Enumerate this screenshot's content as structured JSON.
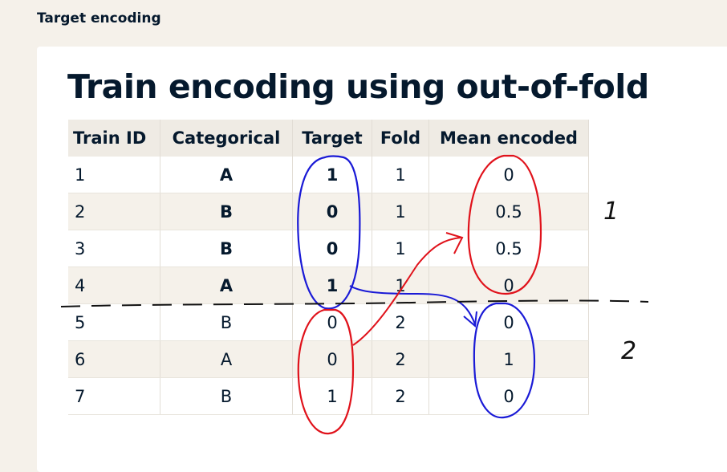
{
  "section_label": "Target encoding",
  "title": "Train encoding using out-of-fold",
  "table": {
    "headers": [
      "Train ID",
      "Categorical",
      "Target",
      "Fold",
      "Mean encoded"
    ],
    "rows": [
      {
        "id": "1",
        "categorical": "A",
        "target": "1",
        "fold": "1",
        "mean": "0"
      },
      {
        "id": "2",
        "categorical": "B",
        "target": "0",
        "fold": "1",
        "mean": "0.5"
      },
      {
        "id": "3",
        "categorical": "B",
        "target": "0",
        "fold": "1",
        "mean": "0.5"
      },
      {
        "id": "4",
        "categorical": "A",
        "target": "1",
        "fold": "1",
        "mean": "0"
      },
      {
        "id": "5",
        "categorical": "B",
        "target": "0",
        "fold": "2",
        "mean": "0"
      },
      {
        "id": "6",
        "categorical": "A",
        "target": "0",
        "fold": "2",
        "mean": "1"
      },
      {
        "id": "7",
        "categorical": "B",
        "target": "1",
        "fold": "2",
        "mean": "0"
      }
    ]
  },
  "annotations": {
    "fold_1_mark": "1",
    "fold_2_mark": "2",
    "colors": {
      "blue": "#1a1ad6",
      "red": "#e0121b",
      "black": "#111111"
    }
  }
}
